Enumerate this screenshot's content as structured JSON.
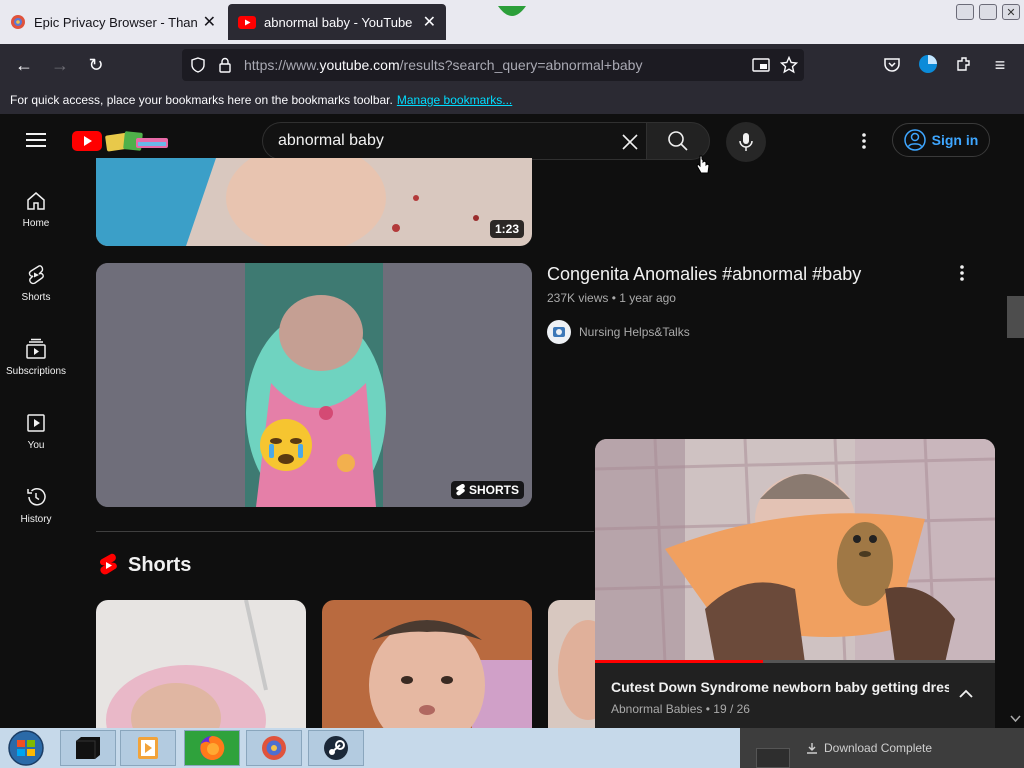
{
  "browser": {
    "tabs": [
      {
        "title": "Epic Privacy Browser - Thank Yo",
        "active": false,
        "icon": "epic-browser-icon"
      },
      {
        "title": "abnormal baby - YouTube",
        "active": true,
        "icon": "youtube-icon"
      }
    ],
    "url_prefix": "https://www.",
    "url_domain": "youtube.com",
    "url_rest": "/results?search_query=abnormal+baby",
    "bookmarks_text": "For quick access, place your bookmarks here on the bookmarks toolbar.",
    "bookmarks_link": "Manage bookmarks..."
  },
  "youtube": {
    "search_value": "abnormal baby",
    "signin_label": "Sign in",
    "sidebar": [
      {
        "label": "Home",
        "icon": "home-icon"
      },
      {
        "label": "Shorts",
        "icon": "shorts-icon"
      },
      {
        "label": "Subscriptions",
        "icon": "subscriptions-icon"
      },
      {
        "label": "You",
        "icon": "you-icon"
      },
      {
        "label": "History",
        "icon": "history-icon"
      }
    ],
    "results": [
      {
        "duration": "1:23"
      },
      {
        "title": "Congenita Anomalies #abnormal #baby",
        "views": "237K views",
        "age": "1 year ago",
        "channel": "Nursing Helps&Talks",
        "badge": "SHORTS"
      }
    ],
    "shorts_heading": "Shorts",
    "miniplayer": {
      "title": "Cutest Down Syndrome newborn baby getting dressec",
      "channel": "Abnormal Babies",
      "position": "19 / 26",
      "progress": 0.42
    }
  },
  "taskbar": {
    "download_notice": "Download Complete"
  },
  "colors": {
    "yt_red": "#ff0000",
    "link_blue": "#3ea6ff",
    "bg": "#0f0f0f"
  }
}
